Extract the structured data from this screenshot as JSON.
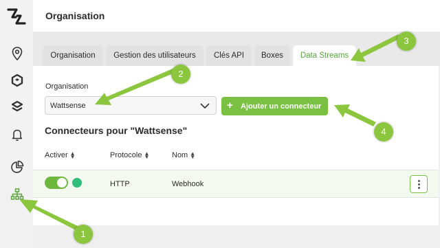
{
  "header": {
    "title": "Organisation"
  },
  "sidebar": {
    "icons": [
      "logo-icon",
      "location-pin-icon",
      "cube-outline-icon",
      "layers-icon",
      "bell-icon",
      "pie-chart-icon",
      "network-icon"
    ]
  },
  "tabs": [
    {
      "label": "Organisation",
      "active": false
    },
    {
      "label": "Gestion des utilisateurs",
      "active": false
    },
    {
      "label": "Clés API",
      "active": false
    },
    {
      "label": "Boxes",
      "active": false
    },
    {
      "label": "Data Streams",
      "active": true
    }
  ],
  "form": {
    "org_label": "Organisation",
    "org_value": "Wattsense",
    "add_button": "Ajouter un connecteur"
  },
  "section_title": "Connecteurs pour \"Wattsense\"",
  "table": {
    "columns": [
      "Activer",
      "Protocole",
      "Nom"
    ],
    "rows": [
      {
        "enabled": true,
        "protocol": "HTTP",
        "name": "Webhook"
      }
    ]
  },
  "annotations": [
    "1",
    "2",
    "3",
    "4"
  ],
  "colors": {
    "accent": "#7ac143",
    "active_tab_text": "#5aa33e",
    "status_dot": "#2fbf7a",
    "row_bg": "#f3f9ef"
  }
}
